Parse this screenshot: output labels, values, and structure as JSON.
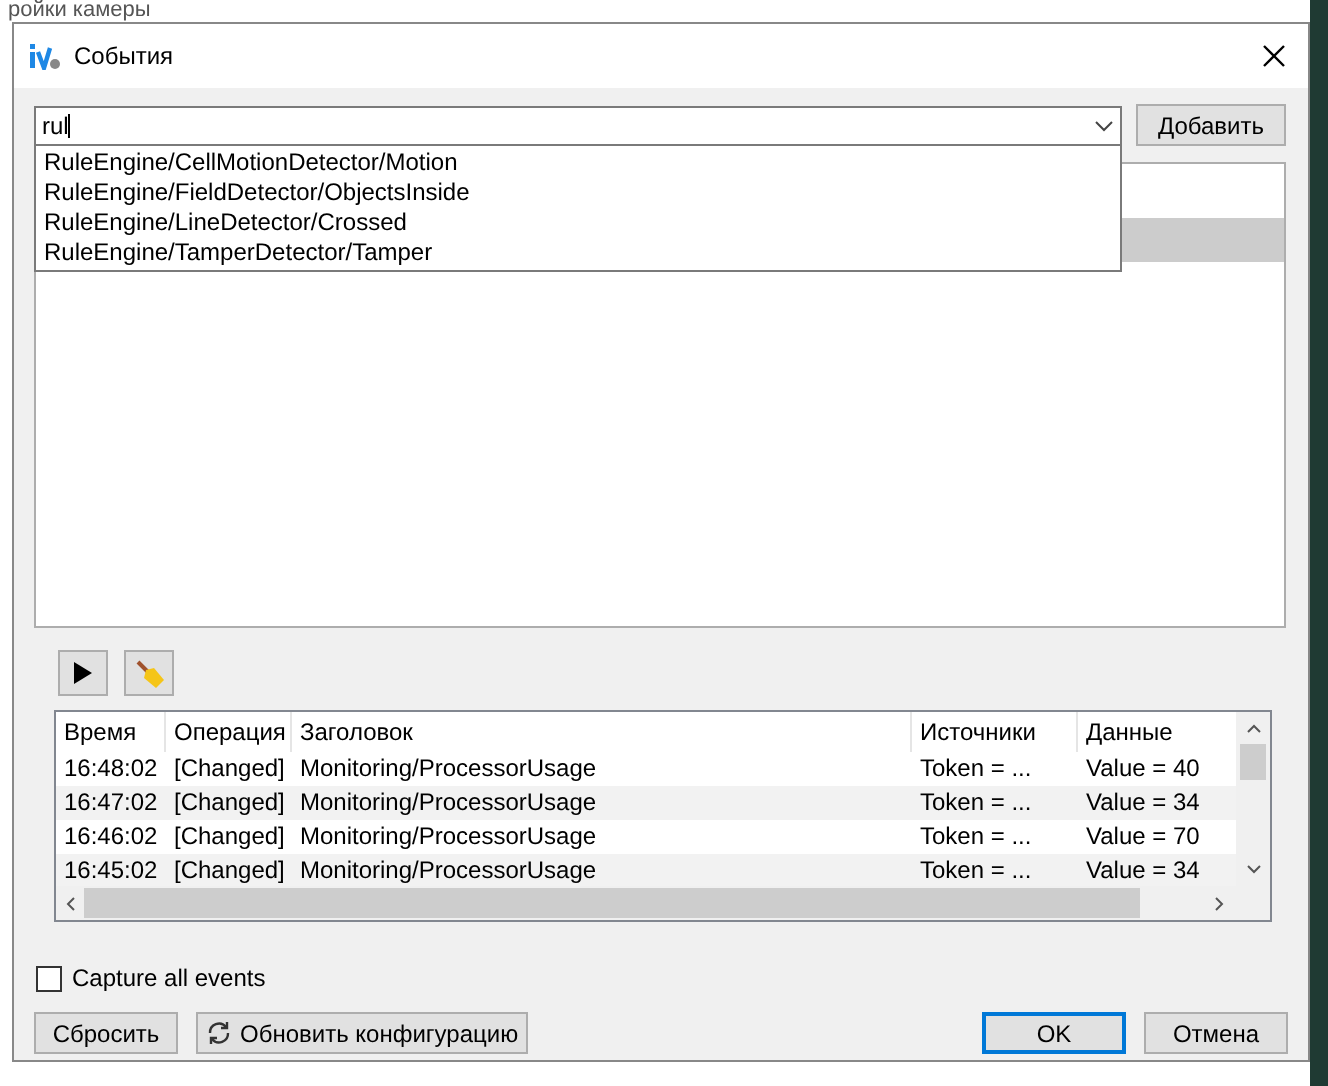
{
  "background_window": {
    "title": "ройки камеры"
  },
  "window": {
    "title": "События"
  },
  "event_combo": {
    "value": "rul",
    "options": [
      "RuleEngine/CellMotionDetector/Motion",
      "RuleEngine/FieldDetector/ObjectsInside",
      "RuleEngine/LineDetector/Crossed",
      "RuleEngine/TamperDetector/Tamper"
    ]
  },
  "add_button": "Добавить",
  "event_list": {
    "rows": [
      {
        "selected": false
      },
      {
        "selected": true
      }
    ]
  },
  "log_table": {
    "columns": [
      "Время",
      "Операция",
      "Заголовок",
      "Источники",
      "Данные"
    ],
    "rows": [
      [
        "16:48:02",
        "[Changed]",
        "Monitoring/ProcessorUsage",
        "Token = ...",
        "Value = 40"
      ],
      [
        "16:47:02",
        "[Changed]",
        "Monitoring/ProcessorUsage",
        "Token = ...",
        "Value = 34"
      ],
      [
        "16:46:02",
        "[Changed]",
        "Monitoring/ProcessorUsage",
        "Token = ...",
        "Value = 70"
      ],
      [
        "16:45:02",
        "[Changed]",
        "Monitoring/ProcessorUsage",
        "Token = ...",
        "Value = 34"
      ]
    ]
  },
  "capture_all": {
    "label": "Capture all events",
    "checked": false
  },
  "buttons": {
    "reset": "Сбросить",
    "refresh": "Обновить конфигурацию",
    "ok": "OK",
    "cancel": "Отмена"
  }
}
